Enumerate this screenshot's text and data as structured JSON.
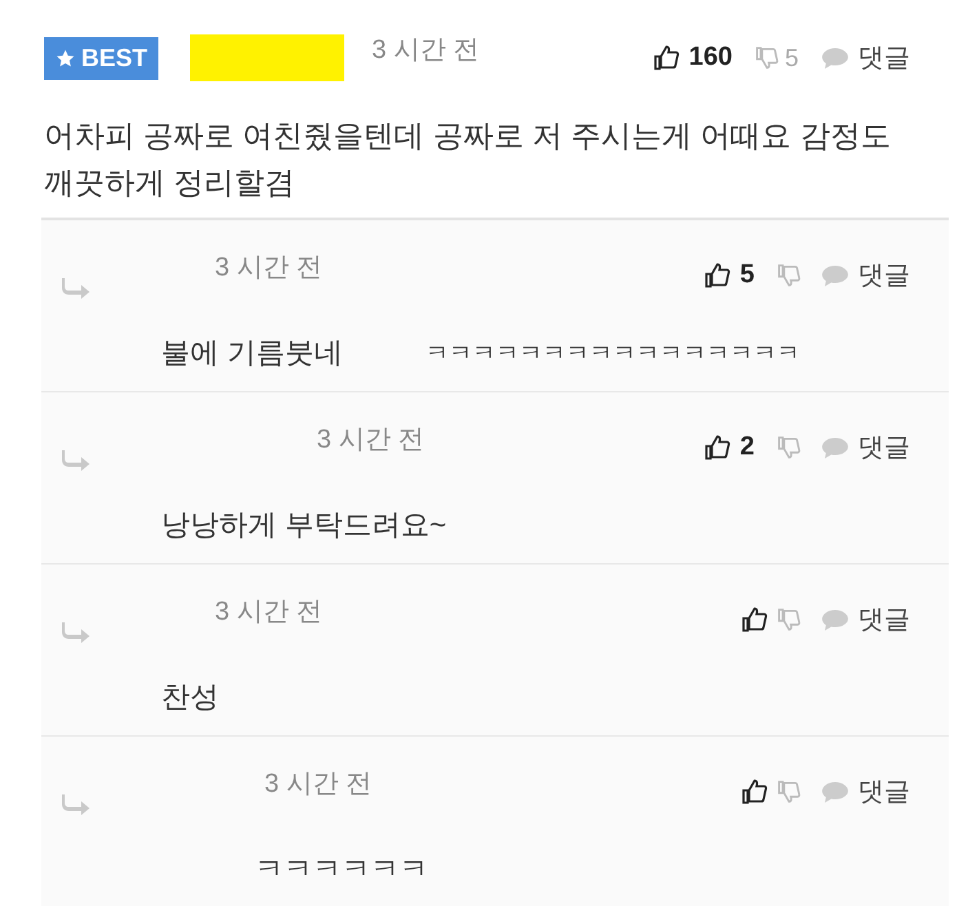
{
  "best_comment": {
    "badge": "BEST",
    "time": "3 시간 전",
    "likes": "160",
    "dislikes": "5",
    "reply_label": "댓글",
    "text": "어차피 공짜로 여친줬을텐데 공짜로 저 주시는게 어때요 감정도 깨끗하게 정리할겸"
  },
  "replies": [
    {
      "time": "3 시간 전",
      "likes": "5",
      "reply_label": "댓글",
      "texts": [
        "불에 기름붓네",
        "ㅋㅋㅋㅋㅋㅋㅋㅋㅋㅋㅋㅋㅋㅋㅋㅋ"
      ]
    },
    {
      "time": "3 시간 전",
      "likes": "2",
      "reply_label": "댓글",
      "texts": [
        "낭낭하게 부탁드려요~"
      ]
    },
    {
      "time": "3 시간 전",
      "reply_label": "댓글",
      "texts": [
        "찬성"
      ]
    },
    {
      "time": "3 시간 전",
      "reply_label": "댓글",
      "texts": [
        "ㅋㅋㅋㅋㅋㅋ"
      ]
    }
  ]
}
